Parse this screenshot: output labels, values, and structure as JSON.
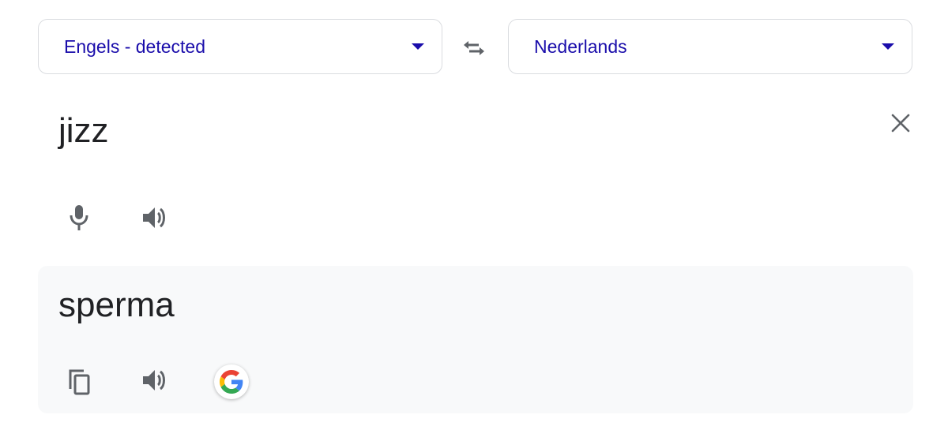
{
  "source_language": {
    "label": "Engels - detected",
    "icon": "chevron-down-icon"
  },
  "target_language": {
    "label": "Nederlands",
    "icon": "chevron-down-icon"
  },
  "swap_icon": "swap-arrows-icon",
  "source": {
    "text": "jizz",
    "clear_icon": "close-icon",
    "mic_icon": "microphone-icon",
    "speak_icon": "speaker-icon"
  },
  "result": {
    "text": "sperma",
    "copy_icon": "copy-icon",
    "speak_icon": "speaker-icon",
    "google_icon": "google-logo-icon"
  },
  "colors": {
    "link_blue": "#1a0dab",
    "icon_gray": "#5f6368",
    "text": "#202124",
    "border": "#dadce0",
    "panel_bg": "#f8f9fa"
  }
}
